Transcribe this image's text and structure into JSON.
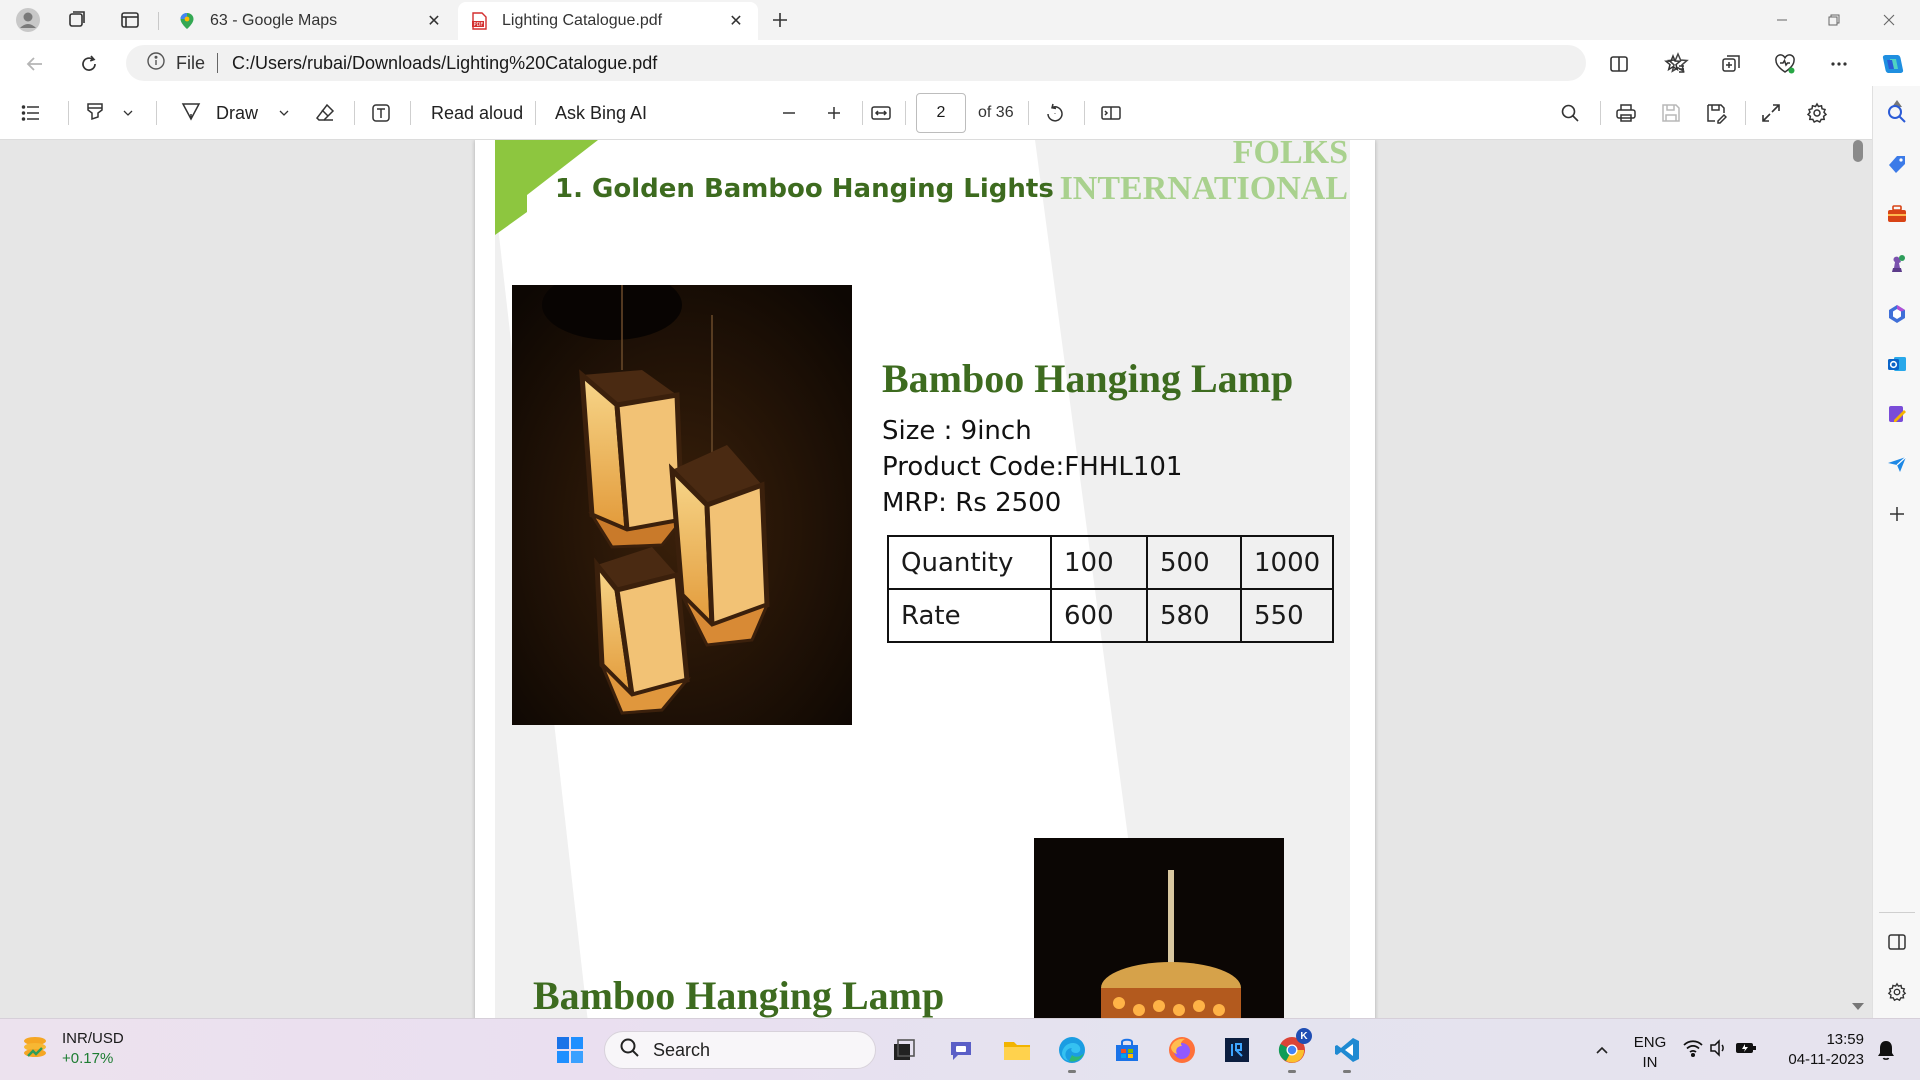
{
  "tabs": [
    {
      "title": "63 - Google Maps",
      "icon": "maps-pin-icon",
      "active": false
    },
    {
      "title": "Lighting Catalogue.pdf",
      "icon": "pdf-file-icon",
      "active": true
    }
  ],
  "address": {
    "label": "File",
    "url": "C:/Users/rubai/Downloads/Lighting%20Catalogue.pdf"
  },
  "pdf_toolbar": {
    "draw_label": "Draw",
    "read_aloud_label": "Read aloud",
    "ask_bing_label": "Ask Bing AI",
    "page_current": "2",
    "page_total": "of 36"
  },
  "document": {
    "heading": "1.  Golden Bamboo Hanging Lights",
    "brand_line1": "FOLKS",
    "brand_line2": "INTERNATIONAL",
    "product": {
      "title": "Bamboo Hanging Lamp",
      "size": "Size :  9inch",
      "code": "Product Code:FHHL101",
      "mrp": "MRP: Rs 2500",
      "table": {
        "rows": [
          [
            "Quantity",
            "100",
            "500",
            "1000"
          ],
          [
            "Rate",
            "600",
            "580",
            "550"
          ]
        ]
      }
    },
    "product2_title": "Bamboo Hanging Lamp"
  },
  "taskbar": {
    "ticker_name": "INR/USD",
    "ticker_change": "+0.17%",
    "search_placeholder": "Search",
    "lang_line1": "ENG",
    "lang_line2": "IN",
    "time": "13:59",
    "date": "04-11-2023",
    "chrome_badge": "K"
  },
  "colors": {
    "heading_green": "#3d6b1f",
    "brand_green": "#a9d18e",
    "accent_green": "#8dc63f"
  }
}
